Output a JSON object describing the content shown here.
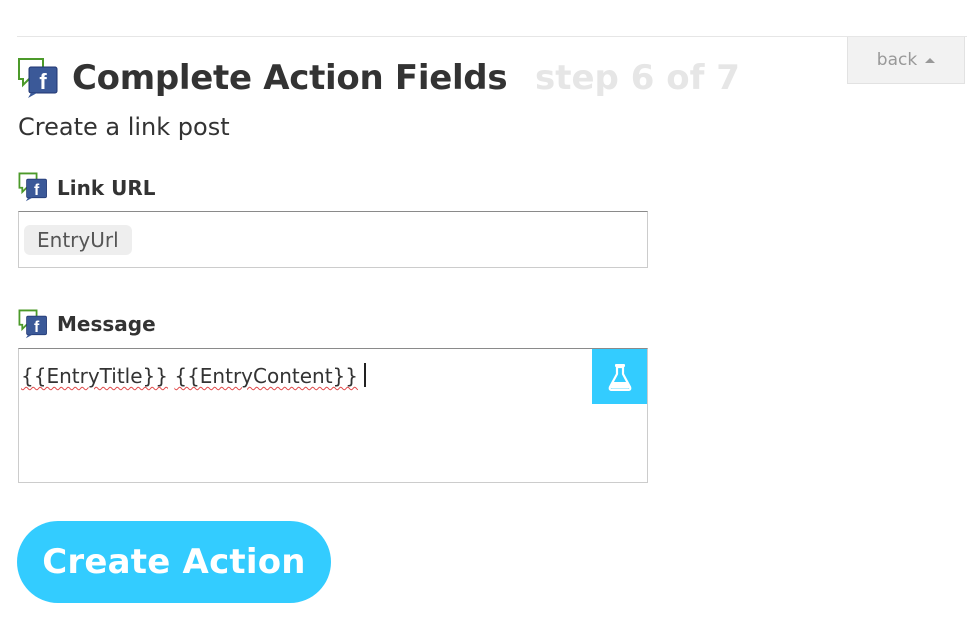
{
  "header": {
    "title": "Complete Action Fields",
    "step": "step 6 of 7",
    "back_label": "back",
    "subtitle": "Create a link post"
  },
  "fields": [
    {
      "label": "Link URL",
      "icon": "facebook-icon",
      "value_pill": "EntryUrl"
    },
    {
      "label": "Message",
      "icon": "facebook-icon",
      "value_text_1": "{{EntryTitle}}",
      "value_text_2": "{{EntryContent}}",
      "action_icon": "flask-icon"
    }
  ],
  "submit": {
    "label": "Create Action"
  },
  "colors": {
    "accent": "#33ccff",
    "facebook_blue": "#3b5998",
    "speech_green": "#4c9a2a",
    "step_grey": "#e6e6e6"
  }
}
